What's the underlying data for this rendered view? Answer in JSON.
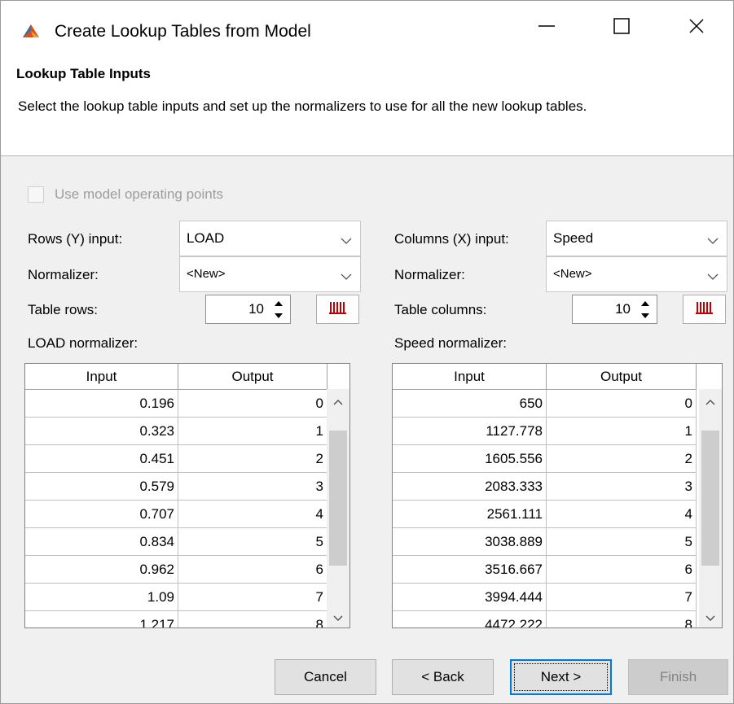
{
  "window": {
    "title": "Create Lookup Tables from Model",
    "controls": {
      "minimize": "minimize",
      "maximize": "maximize",
      "close": "close"
    }
  },
  "header": {
    "title": "Lookup Table Inputs",
    "description": "Select the lookup table inputs and set up the normalizers to use for all the new lookup tables."
  },
  "options": {
    "use_operating_points": {
      "label": "Use model operating points",
      "checked": false,
      "enabled": false
    }
  },
  "rows": {
    "input_label": "Rows (Y) input:",
    "input_value": "LOAD",
    "normalizer_label": "Normalizer:",
    "normalizer_value": "<New>",
    "count_label": "Table rows:",
    "count_value": "10",
    "table_title": "LOAD normalizer:",
    "columns": [
      "Input",
      "Output"
    ],
    "data": [
      [
        "0.196",
        "0"
      ],
      [
        "0.323",
        "1"
      ],
      [
        "0.451",
        "2"
      ],
      [
        "0.579",
        "3"
      ],
      [
        "0.707",
        "4"
      ],
      [
        "0.834",
        "5"
      ],
      [
        "0.962",
        "6"
      ],
      [
        "1.09",
        "7"
      ],
      [
        "1.217",
        "8"
      ]
    ]
  },
  "cols": {
    "input_label": "Columns (X) input:",
    "input_value": "Speed",
    "normalizer_label": "Normalizer:",
    "normalizer_value": "<New>",
    "count_label": "Table columns:",
    "count_value": "10",
    "table_title": "Speed normalizer:",
    "columns": [
      "Input",
      "Output"
    ],
    "data": [
      [
        "650",
        "0"
      ],
      [
        "1127.778",
        "1"
      ],
      [
        "1605.556",
        "2"
      ],
      [
        "2083.333",
        "3"
      ],
      [
        "2561.111",
        "4"
      ],
      [
        "3038.889",
        "5"
      ],
      [
        "3516.667",
        "6"
      ],
      [
        "3994.444",
        "7"
      ],
      [
        "4472.222",
        "8"
      ]
    ]
  },
  "buttons": {
    "cancel": "Cancel",
    "back": "< Back",
    "next": "Next >",
    "finish": "Finish"
  },
  "colors": {
    "accent": "#0078d7",
    "app_icon": "#d95319",
    "normalizer_icon": "#c00000"
  },
  "icons": {
    "app": "matlab-logo-icon",
    "normalizer": "normalizer-bars-icon"
  }
}
